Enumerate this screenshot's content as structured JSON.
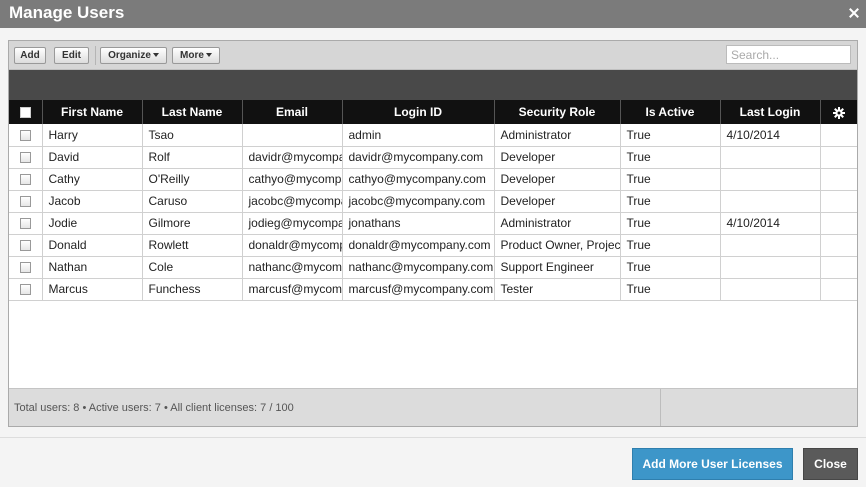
{
  "window": {
    "title": "Manage Users"
  },
  "toolbar": {
    "add_label": "Add",
    "edit_label": "Edit",
    "organize_label": "Organize",
    "more_label": "More",
    "search_placeholder": "Search..."
  },
  "table": {
    "columns": [
      "First Name",
      "Last Name",
      "Email",
      "Login ID",
      "Security Role",
      "Is Active",
      "Last Login"
    ],
    "rows": [
      [
        "Harry",
        "Tsao",
        "",
        "admin",
        "Administrator",
        "True",
        "4/10/2014"
      ],
      [
        "David",
        "Rolf",
        "davidr@mycompany.com",
        "davidr@mycompany.com",
        "Developer",
        "True",
        ""
      ],
      [
        "Cathy",
        "O'Reilly",
        "cathyo@mycompany.com",
        "cathyo@mycompany.com",
        "Developer",
        "True",
        ""
      ],
      [
        "Jacob",
        "Caruso",
        "jacobc@mycompany.com",
        "jacobc@mycompany.com",
        "Developer",
        "True",
        ""
      ],
      [
        "Jodie",
        "Gilmore",
        "jodieg@mycompany.com",
        "jonathans",
        "Administrator",
        "True",
        "4/10/2014"
      ],
      [
        "Donald",
        "Rowlett",
        "donaldr@mycompany.com",
        "donaldr@mycompany.com",
        "Product Owner, Project Manager",
        "True",
        ""
      ],
      [
        "Nathan",
        "Cole",
        "nathanc@mycompany.com",
        "nathanc@mycompany.com",
        "Support Engineer",
        "True",
        ""
      ],
      [
        "Marcus",
        "Funchess",
        "marcusf@mycompany.com",
        "marcusf@mycompany.com",
        "Tester",
        "True",
        ""
      ]
    ]
  },
  "footer": {
    "summary": "Total users: 8 • Active users: 7 • All client licenses: 7 / 100"
  },
  "actions": {
    "add_licenses_label": "Add More User Licenses",
    "close_label": "Close"
  },
  "colors": {
    "accent": "#3d96c9",
    "close_button": "#5a5a5a",
    "header": "#111111",
    "titlebar": "#7b7b7b"
  },
  "icons": {
    "settings": "gear-icon",
    "window_close": "close-icon"
  }
}
